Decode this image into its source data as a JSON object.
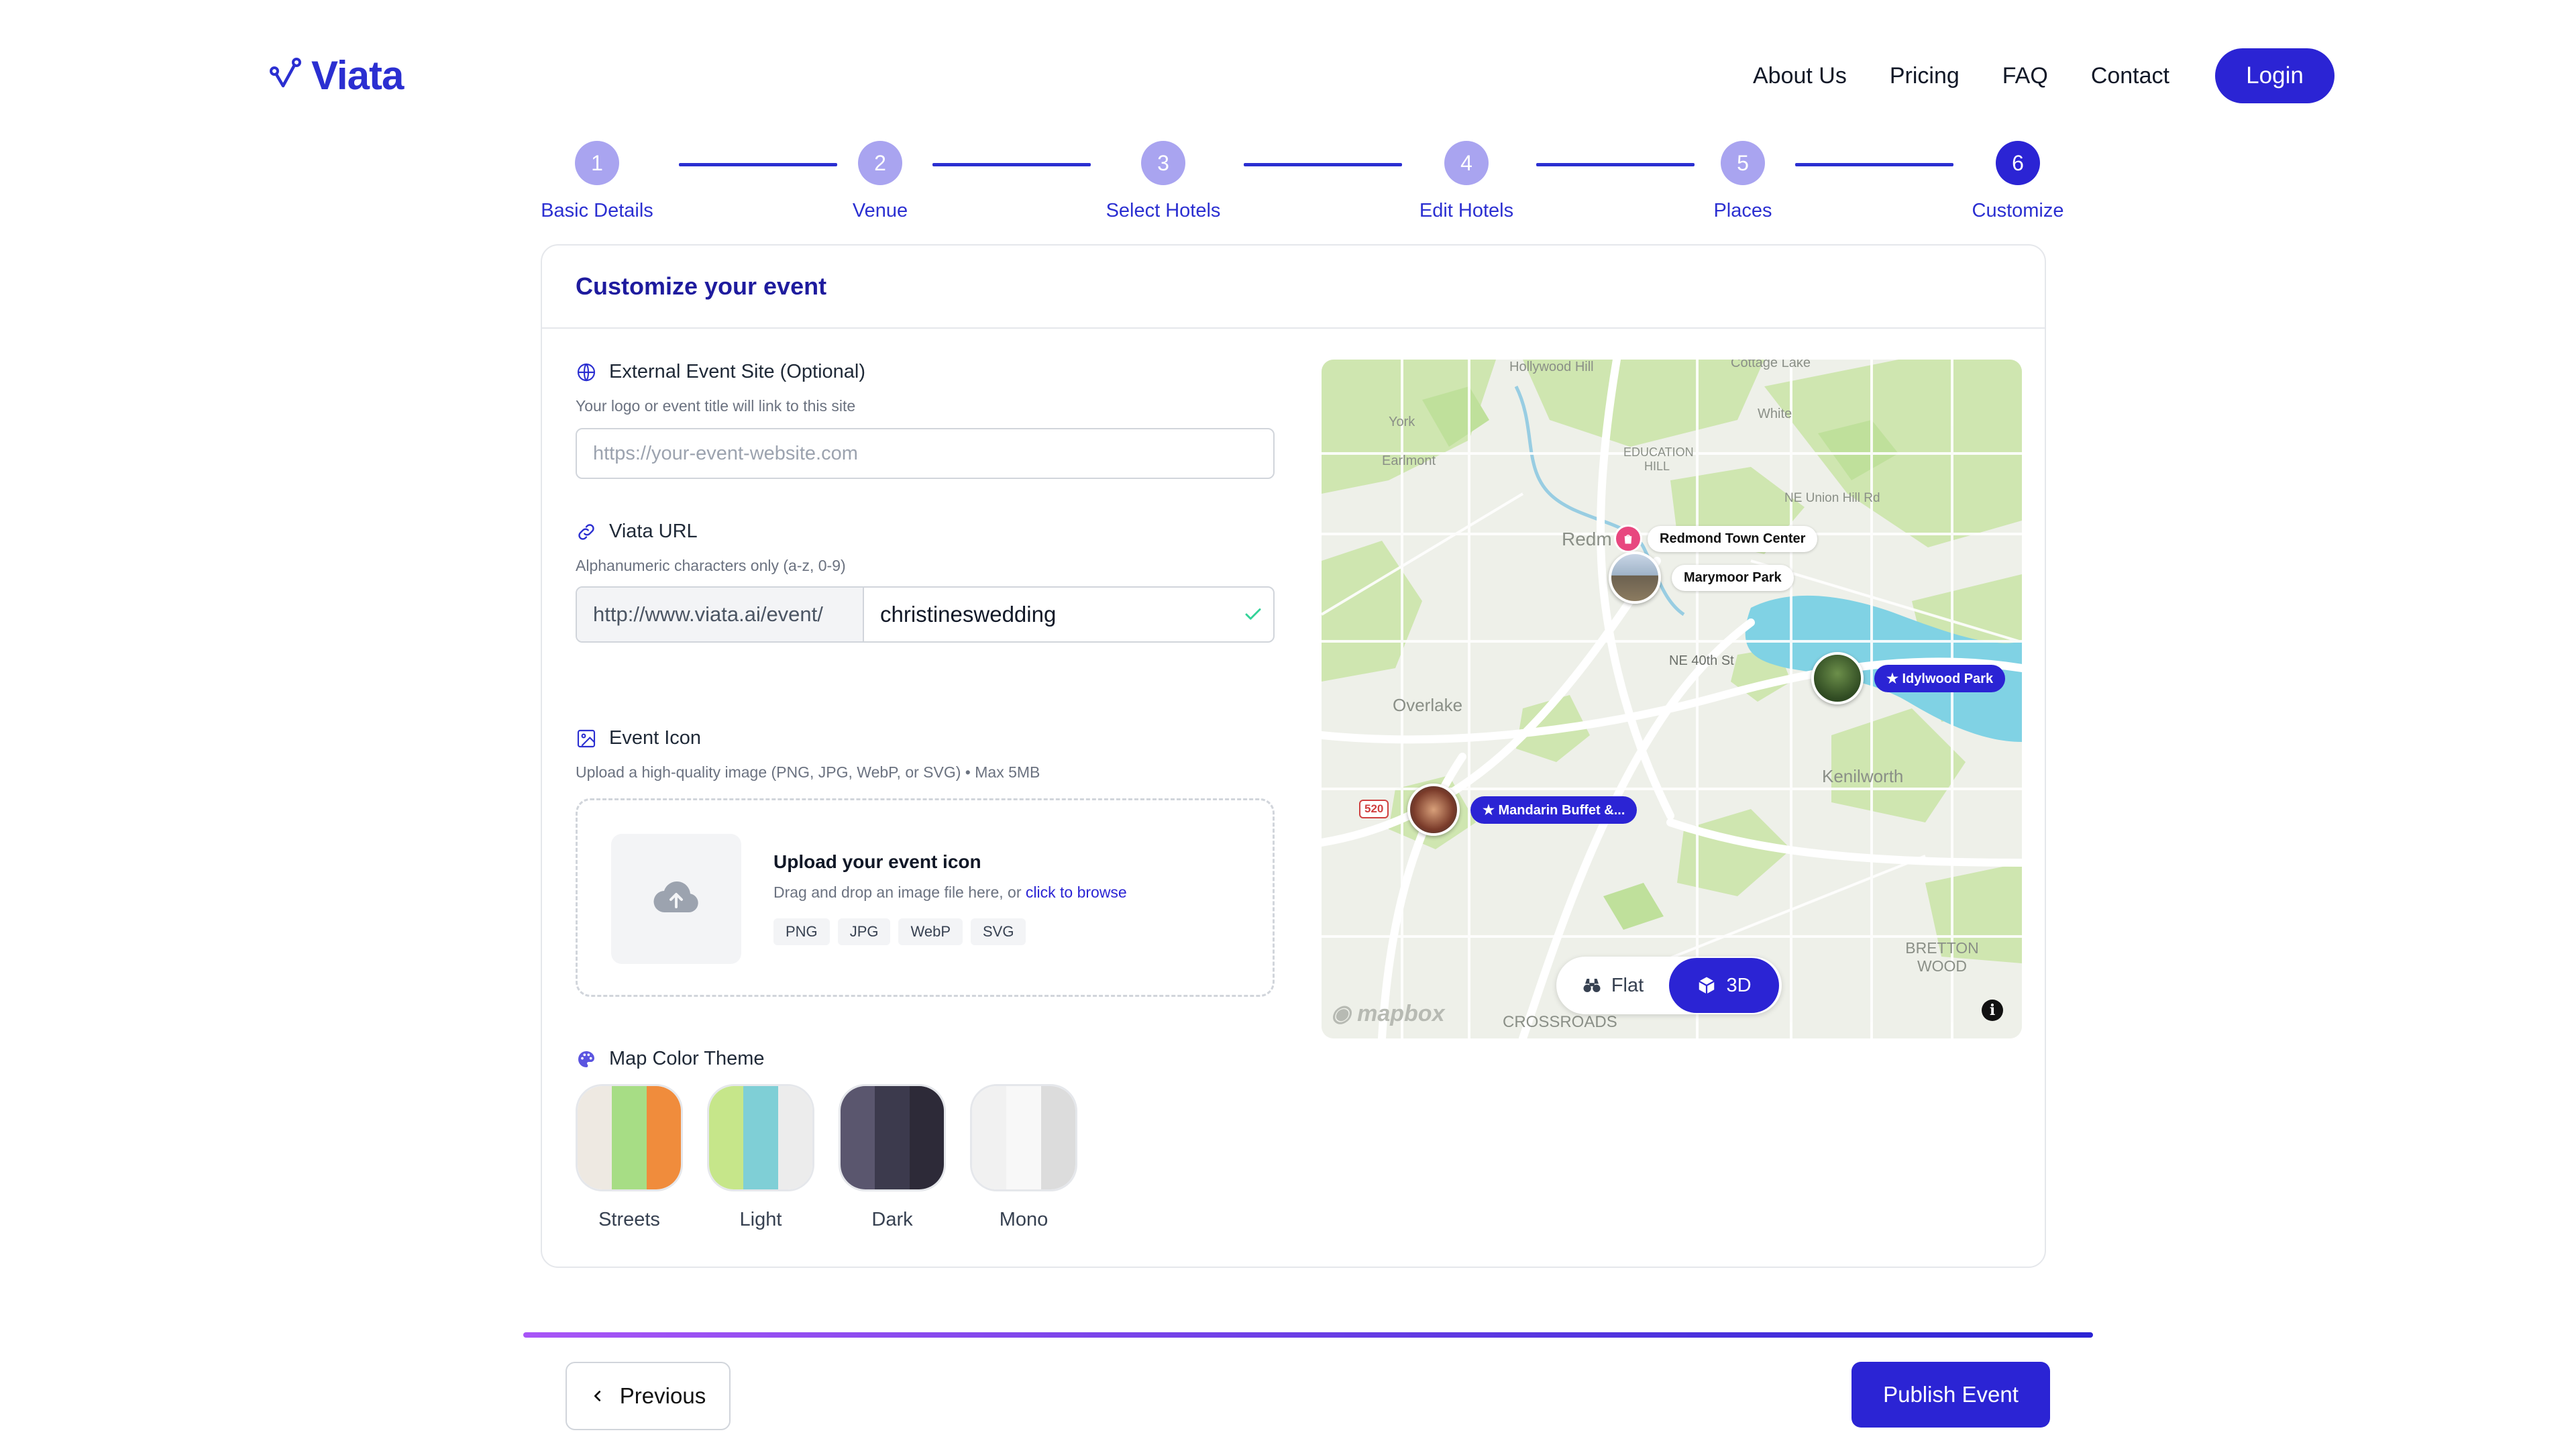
{
  "brand": {
    "name": "Viata",
    "color": "#2b2fd1"
  },
  "nav": {
    "links": [
      "About Us",
      "Pricing",
      "FAQ",
      "Contact"
    ],
    "login_label": "Login"
  },
  "stepper": {
    "steps": [
      {
        "number": "1",
        "label": "Basic Details"
      },
      {
        "number": "2",
        "label": "Venue"
      },
      {
        "number": "3",
        "label": "Select Hotels"
      },
      {
        "number": "4",
        "label": "Edit Hotels"
      },
      {
        "number": "5",
        "label": "Places"
      },
      {
        "number": "6",
        "label": "Customize"
      }
    ],
    "active_step": 6
  },
  "card": {
    "title": "Customize your event",
    "external_site": {
      "label": "External Event Site (Optional)",
      "help": "Your logo or event title will link to this site",
      "placeholder": "https://your-event-website.com",
      "value": ""
    },
    "viata_url": {
      "label": "Viata URL",
      "help": "Alphanumeric characters only (a-z, 0-9)",
      "prefix": "http://www.viata.ai/event/",
      "value": "christineswedding",
      "valid": true
    },
    "event_icon": {
      "label": "Event Icon",
      "help": "Upload a high-quality image (PNG, JPG, WebP, or SVG) • Max 5MB",
      "upload_title": "Upload your event icon",
      "upload_desc": "Drag and drop an image file here, or ",
      "browse_link": "click to browse",
      "formats": [
        "PNG",
        "JPG",
        "WebP",
        "SVG"
      ]
    },
    "map_theme": {
      "label": "Map Color Theme",
      "options": [
        {
          "name": "Streets",
          "colors": [
            "#eee9e2",
            "#a7dd85",
            "#f08c3c"
          ]
        },
        {
          "name": "Light",
          "colors": [
            "#c6e68a",
            "#7fcfd6",
            "#ececec"
          ]
        },
        {
          "name": "Dark",
          "colors": [
            "#5a566e",
            "#3c3a4d",
            "#2d2a38"
          ]
        },
        {
          "name": "Mono",
          "colors": [
            "#f1f1f1",
            "#f8f8f8",
            "#dcdcdc"
          ]
        }
      ]
    }
  },
  "map": {
    "place_labels": [
      "Hollywood Hill",
      "Cottage Lake",
      "York",
      "White",
      "Earlmont",
      "EDUCATION HILL",
      "NE Union Hill Rd",
      "Redm",
      "NE 40th St",
      "Overlake",
      "Kenilworth",
      "BRETTON WOOD",
      "CROSSROADS",
      "520"
    ],
    "pins": [
      {
        "name": "Redmond Town Center",
        "style": "white"
      },
      {
        "name": "Marymoor Park",
        "style": "white"
      },
      {
        "name": "Idylwood Park",
        "style": "blue"
      },
      {
        "name": "Mandarin Buffet &...",
        "style": "blue"
      }
    ],
    "view_toggle": {
      "flat_label": "Flat",
      "three_d_label": "3D",
      "active": "3D"
    },
    "attribution": "mapbox",
    "info_label": "i"
  },
  "footer": {
    "previous_label": "Previous",
    "publish_label": "Publish Event"
  }
}
